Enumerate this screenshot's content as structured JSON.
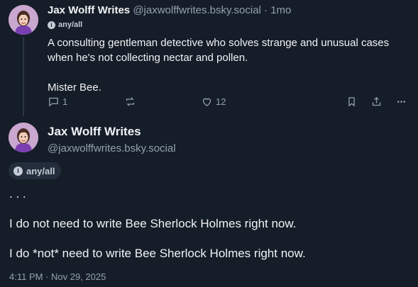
{
  "parent_post": {
    "author_name": "Jax Wolff Writes",
    "handle": "@jaxwolffwrites.bsky.social",
    "separator": "·",
    "time_ago": "1mo",
    "label": "any/all",
    "text_lines": [
      "A consulting gentleman detective who solves strange and unusual cases when he's not collecting nectar and pollen.",
      "Mister Bee."
    ],
    "actions": {
      "reply_count": "1",
      "repost_count": "",
      "like_count": "12"
    }
  },
  "main_post": {
    "author_name": "Jax Wolff Writes",
    "handle": "@jaxwolffwrites.bsky.social",
    "label": "any/all",
    "text_lines": [
      ". . .",
      "I do not need to write Bee Sherlock Holmes right now.",
      "I do *not* need to write Bee Sherlock Holmes right now."
    ],
    "timestamp": "4:11 PM · Nov 29, 2025"
  },
  "icons": {
    "label": "label-icon",
    "reply": "reply-icon",
    "repost": "repost-icon",
    "like": "heart-icon",
    "bookmark": "bookmark-icon",
    "share": "share-icon",
    "more": "more-icon"
  },
  "colors": {
    "background": "#151d28",
    "text": "#f1f3f5",
    "muted": "#93a0b0",
    "avatar_bg": "#c9a7cf"
  }
}
